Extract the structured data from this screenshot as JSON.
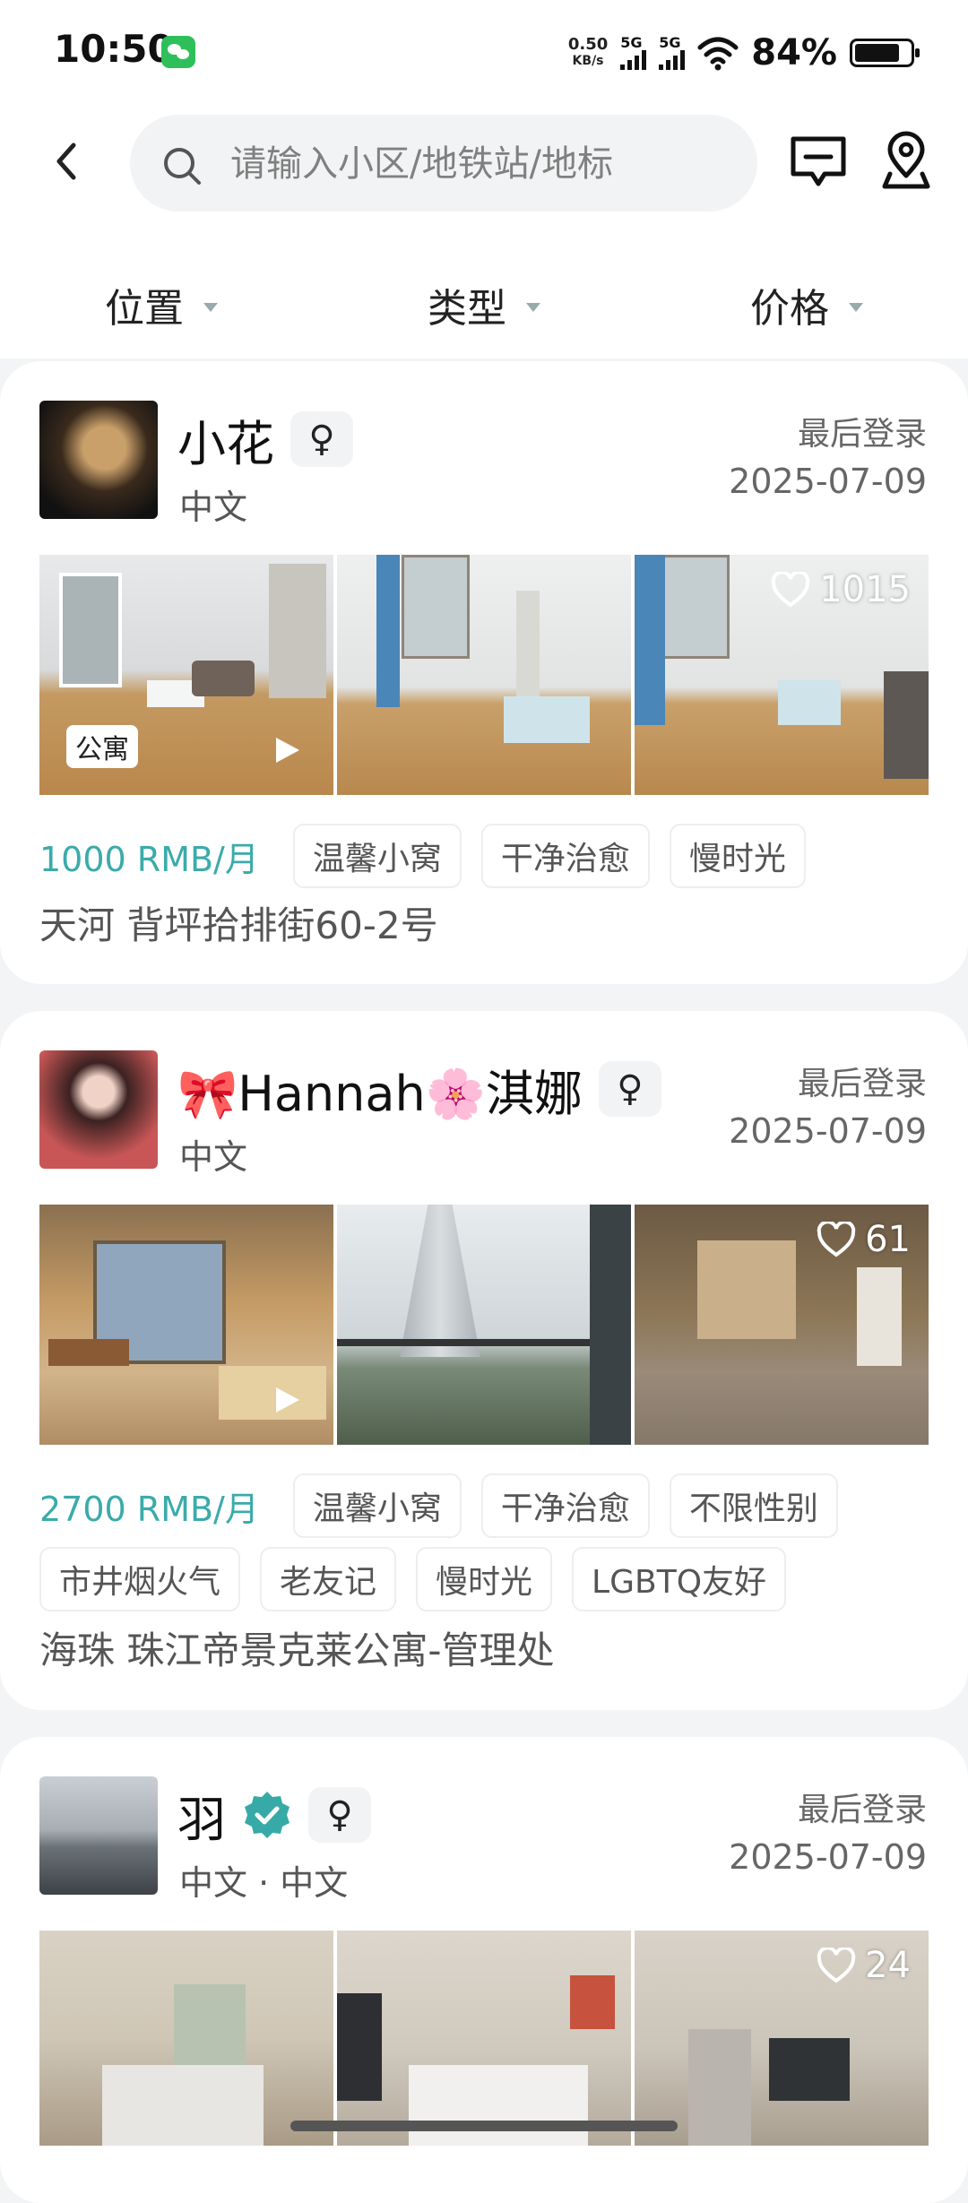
{
  "status_bar": {
    "time": "10:50",
    "speed_value": "0.50",
    "speed_unit": "KB/s",
    "net1": "5G",
    "net2": "5G",
    "battery_percent": "84%",
    "battery_level": 0.84,
    "notification_icon": "wechat-icon"
  },
  "header": {
    "search_placeholder": "请输入小区/地铁站/地标",
    "filters": [
      {
        "label": "位置"
      },
      {
        "label": "类型"
      },
      {
        "label": "价格"
      }
    ]
  },
  "listings": [
    {
      "name": "小花",
      "gender": "♀",
      "verified": false,
      "language": "中文",
      "login_label": "最后登录",
      "login_date": "2025-07-09",
      "type_badge": "公寓",
      "likes": "1015",
      "price": "1000 RMB/月",
      "tags_row1": [
        "温馨小窝",
        "干净治愈",
        "慢时光"
      ],
      "tags_row2": [],
      "address": "天河 背坪拾排街60-2号"
    },
    {
      "name": "🎀Hannah🌸淇娜",
      "gender": "♀",
      "verified": false,
      "language": "中文",
      "login_label": "最后登录",
      "login_date": "2025-07-09",
      "likes": "61",
      "price": "2700 RMB/月",
      "tags_row1": [
        "温馨小窝",
        "干净治愈",
        "不限性别"
      ],
      "tags_row2": [
        "市井烟火气",
        "老友记",
        "慢时光",
        "LGBTQ友好"
      ],
      "address": "海珠 珠江帝景克莱公寓-管理处"
    },
    {
      "name": "羽",
      "gender": "♀",
      "verified": true,
      "language": "中文 · 中文",
      "login_label": "最后登录",
      "login_date": "2025-07-09",
      "likes": "24"
    }
  ]
}
